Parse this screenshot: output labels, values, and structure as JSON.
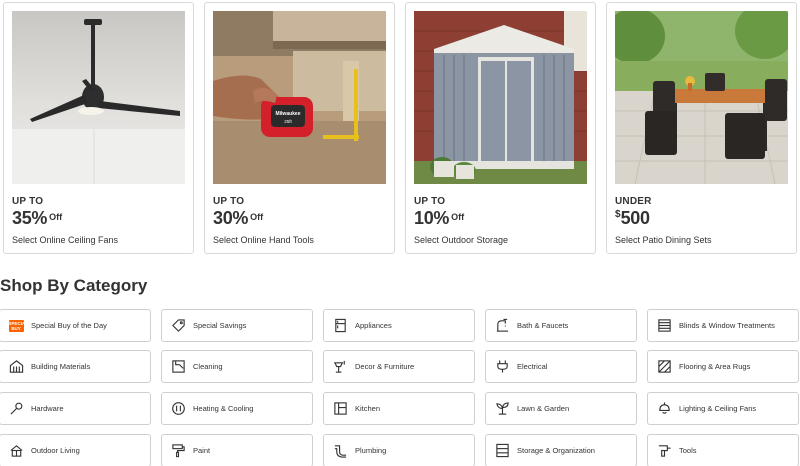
{
  "promos": [
    {
      "pre": "UP TO",
      "amount": "35%",
      "suffix": "Off",
      "dollar": "",
      "desc": "Select Online Ceiling Fans",
      "image": "ceiling-fan"
    },
    {
      "pre": "UP TO",
      "amount": "30%",
      "suffix": "Off",
      "dollar": "",
      "desc": "Select Online Hand Tools",
      "image": "tape-measure"
    },
    {
      "pre": "UP TO",
      "amount": "10%",
      "suffix": "Off",
      "dollar": "",
      "desc": "Select Outdoor Storage",
      "image": "storage-shed"
    },
    {
      "pre": "UNDER",
      "amount": "500",
      "suffix": "",
      "dollar": "$",
      "desc": "Select Patio Dining Sets",
      "image": "patio-dining-set"
    }
  ],
  "product_marks": {
    "tape_brand": "Milwaukee",
    "tape_size": "25ft"
  },
  "section_title": "Shop By Category",
  "categories": [
    {
      "label": "Special Buy of the Day",
      "icon": "special-buy-badge-icon",
      "badge": "SPECIAL BUY"
    },
    {
      "label": "Special Savings",
      "icon": "tag-icon"
    },
    {
      "label": "Appliances",
      "icon": "refrigerator-icon"
    },
    {
      "label": "Bath & Faucets",
      "icon": "faucet-icon"
    },
    {
      "label": "Blinds & Window Treatments",
      "icon": "blinds-icon"
    },
    {
      "label": "Building Materials",
      "icon": "building-icon"
    },
    {
      "label": "Cleaning",
      "icon": "cleaning-icon"
    },
    {
      "label": "Decor & Furniture",
      "icon": "lamp-icon"
    },
    {
      "label": "Electrical",
      "icon": "plug-icon"
    },
    {
      "label": "Flooring & Area Rugs",
      "icon": "flooring-icon"
    },
    {
      "label": "Hardware",
      "icon": "wrench-icon"
    },
    {
      "label": "Heating & Cooling",
      "icon": "thermostat-icon"
    },
    {
      "label": "Kitchen",
      "icon": "kitchen-icon"
    },
    {
      "label": "Lawn & Garden",
      "icon": "plant-icon"
    },
    {
      "label": "Lighting & Ceiling Fans",
      "icon": "ceiling-light-icon"
    },
    {
      "label": "Outdoor Living",
      "icon": "grill-icon"
    },
    {
      "label": "Paint",
      "icon": "paint-roller-icon"
    },
    {
      "label": "Plumbing",
      "icon": "pipe-icon"
    },
    {
      "label": "Storage & Organization",
      "icon": "shelving-icon"
    },
    {
      "label": "Tools",
      "icon": "drill-icon"
    }
  ],
  "colors": {
    "accent": "#f96302",
    "text": "#333333",
    "border": "#d9d9d9"
  }
}
